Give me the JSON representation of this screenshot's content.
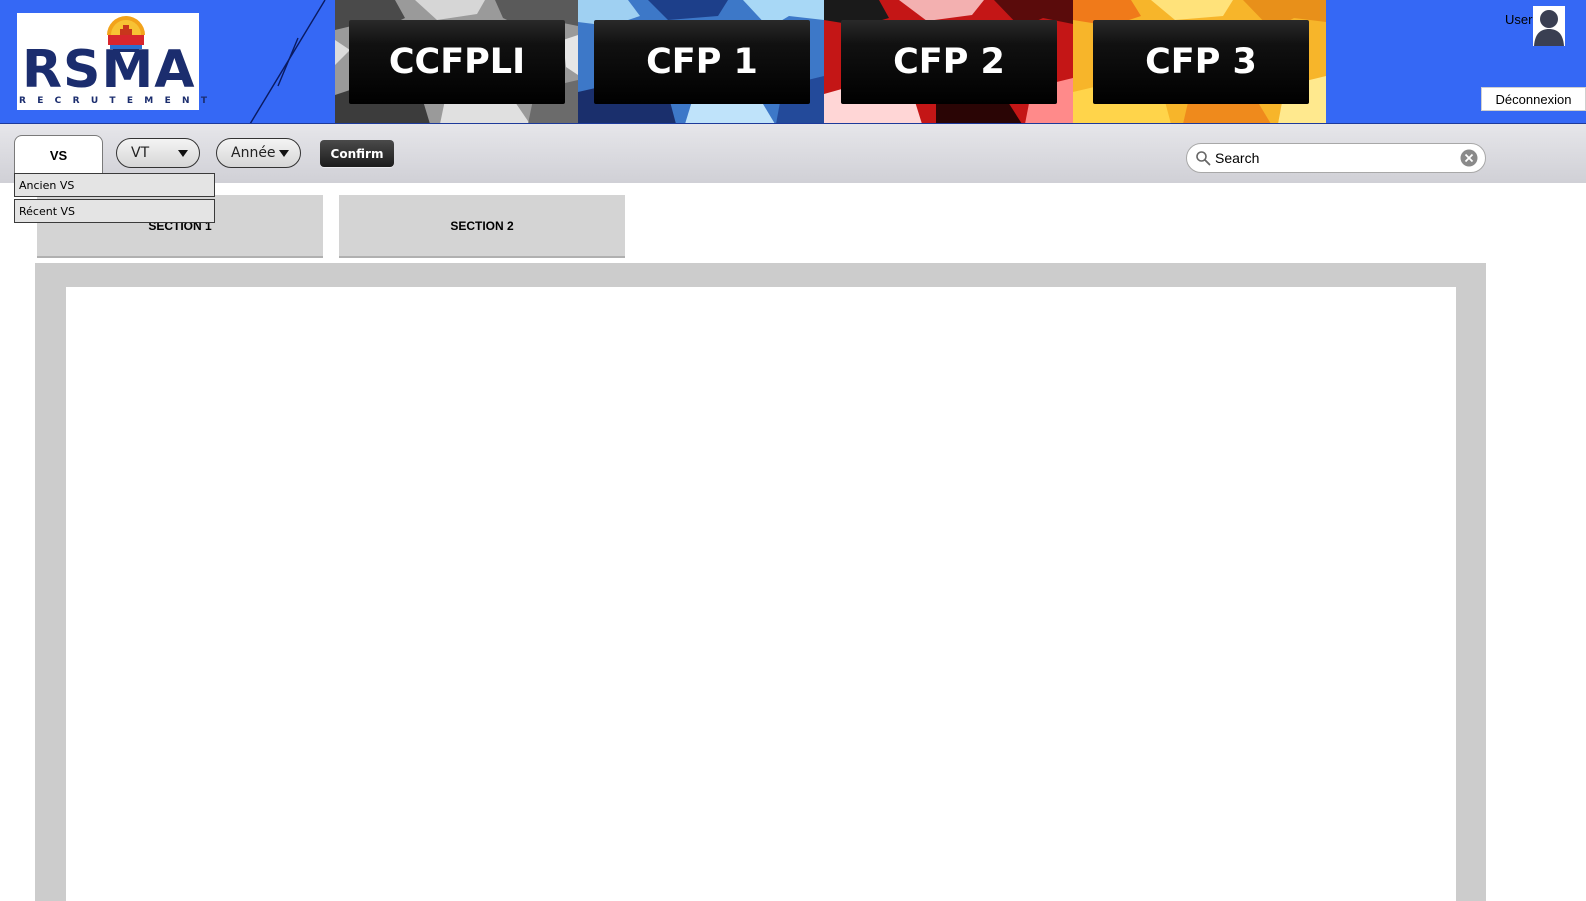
{
  "header": {
    "logo": {
      "main": "RSMA",
      "sub": "RECRUTEMENT"
    },
    "tiles": [
      {
        "label": "CCFPLI",
        "camo": "grey"
      },
      {
        "label": "CFP 1",
        "camo": "blue"
      },
      {
        "label": "CFP 2",
        "camo": "red"
      },
      {
        "label": "CFP 3",
        "camo": "yellow"
      }
    ],
    "user_label": "User",
    "logout_label": "Déconnexion"
  },
  "toolbar": {
    "vs_tab_label": "VS",
    "vt_select": "VT",
    "year_select": "Année",
    "confirm_label": "Confirm",
    "search_placeholder": "Search"
  },
  "dropdown": {
    "items": [
      "Ancien VS",
      "Récent VS"
    ]
  },
  "sections": [
    "SECTION 1",
    "SECTION 2"
  ],
  "colors": {
    "header_bg": "#3568f5",
    "toolbar_bg": "#d8d8dd",
    "content_frame": "#cccccc"
  }
}
